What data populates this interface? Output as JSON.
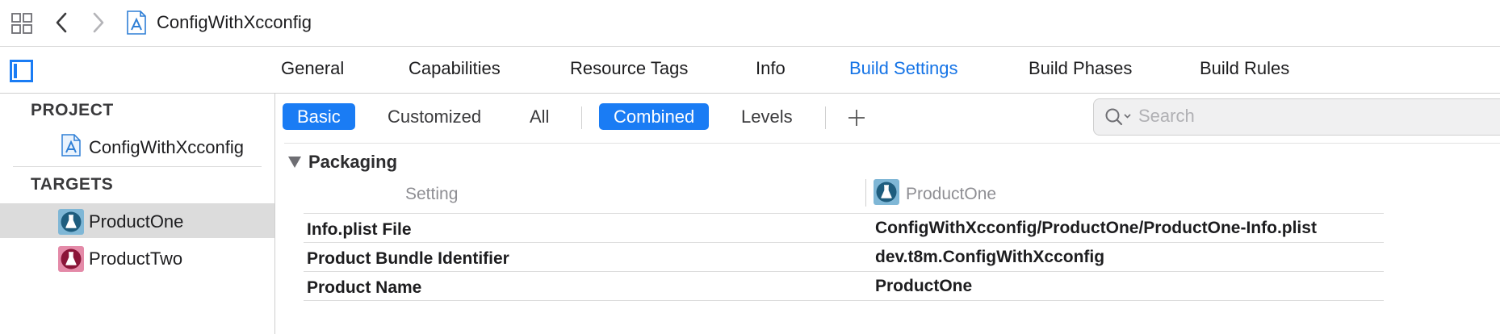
{
  "toolbar": {
    "breadcrumb": "ConfigWithXcconfig"
  },
  "tabs": [
    {
      "label": "General"
    },
    {
      "label": "Capabilities"
    },
    {
      "label": "Resource Tags"
    },
    {
      "label": "Info"
    },
    {
      "label": "Build Settings",
      "active": true
    },
    {
      "label": "Build Phases"
    },
    {
      "label": "Build Rules"
    }
  ],
  "sidebar": {
    "project_header": "PROJECT",
    "project_item": "ConfigWithXcconfig",
    "targets_header": "TARGETS",
    "targets": [
      {
        "label": "ProductOne",
        "selected": true,
        "icon_color": "#1e5d7e"
      },
      {
        "label": "ProductTwo",
        "selected": false,
        "icon_color": "#8a1538"
      }
    ]
  },
  "filters": {
    "scope": [
      "Basic",
      "Customized",
      "All"
    ],
    "scope_selected": "Basic",
    "view": [
      "Combined",
      "Levels"
    ],
    "view_selected": "Combined",
    "search_placeholder": "Search"
  },
  "section": {
    "title": "Packaging",
    "col_setting": "Setting",
    "col_target": "ProductOne",
    "rows": [
      {
        "name": "Info.plist File",
        "value": "ConfigWithXcconfig/ProductOne/ProductOne-Info.plist"
      },
      {
        "name": "Product Bundle Identifier",
        "value": "dev.t8m.ConfigWithXcconfig"
      },
      {
        "name": "Product Name",
        "value": "ProductOne"
      }
    ]
  },
  "colors": {
    "accent": "#1a7cf4",
    "active_tab": "#1473e6",
    "selection": "#dcdcdc"
  }
}
